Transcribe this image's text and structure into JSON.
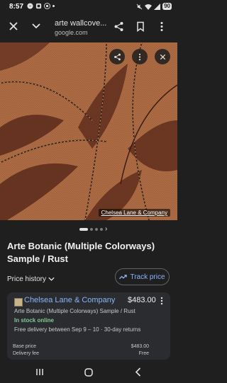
{
  "status_bar": {
    "time": "8:57",
    "battery": "90"
  },
  "browser": {
    "page_title": "arte wallcove...",
    "url": "google.com"
  },
  "image": {
    "caption": "Chelsea Lane & Company",
    "carousel_count": 4,
    "carousel_active": 0
  },
  "product": {
    "title": "Arte Botanic (Multiple Colorways) Sample / Rust"
  },
  "price_history_label": "Price history",
  "track_price_label": "Track price",
  "offer": {
    "store": "Chelsea Lane & Company",
    "price": "$483.00",
    "description": "Arte Botanic (Multiple Colorways) Sample / Rust",
    "stock": "In stock online",
    "delivery": "Free delivery between Sep 9 – 10 · 30-day returns",
    "base_price_label": "Base price",
    "base_price_value": "$483.00",
    "delivery_fee_label": "Delivery fee",
    "delivery_fee_value": "Free"
  },
  "colors": {
    "accent_blue": "#8ab4f8",
    "in_stock_green": "#81c995",
    "background": "#1f1f1f",
    "card": "#2a2c30"
  }
}
